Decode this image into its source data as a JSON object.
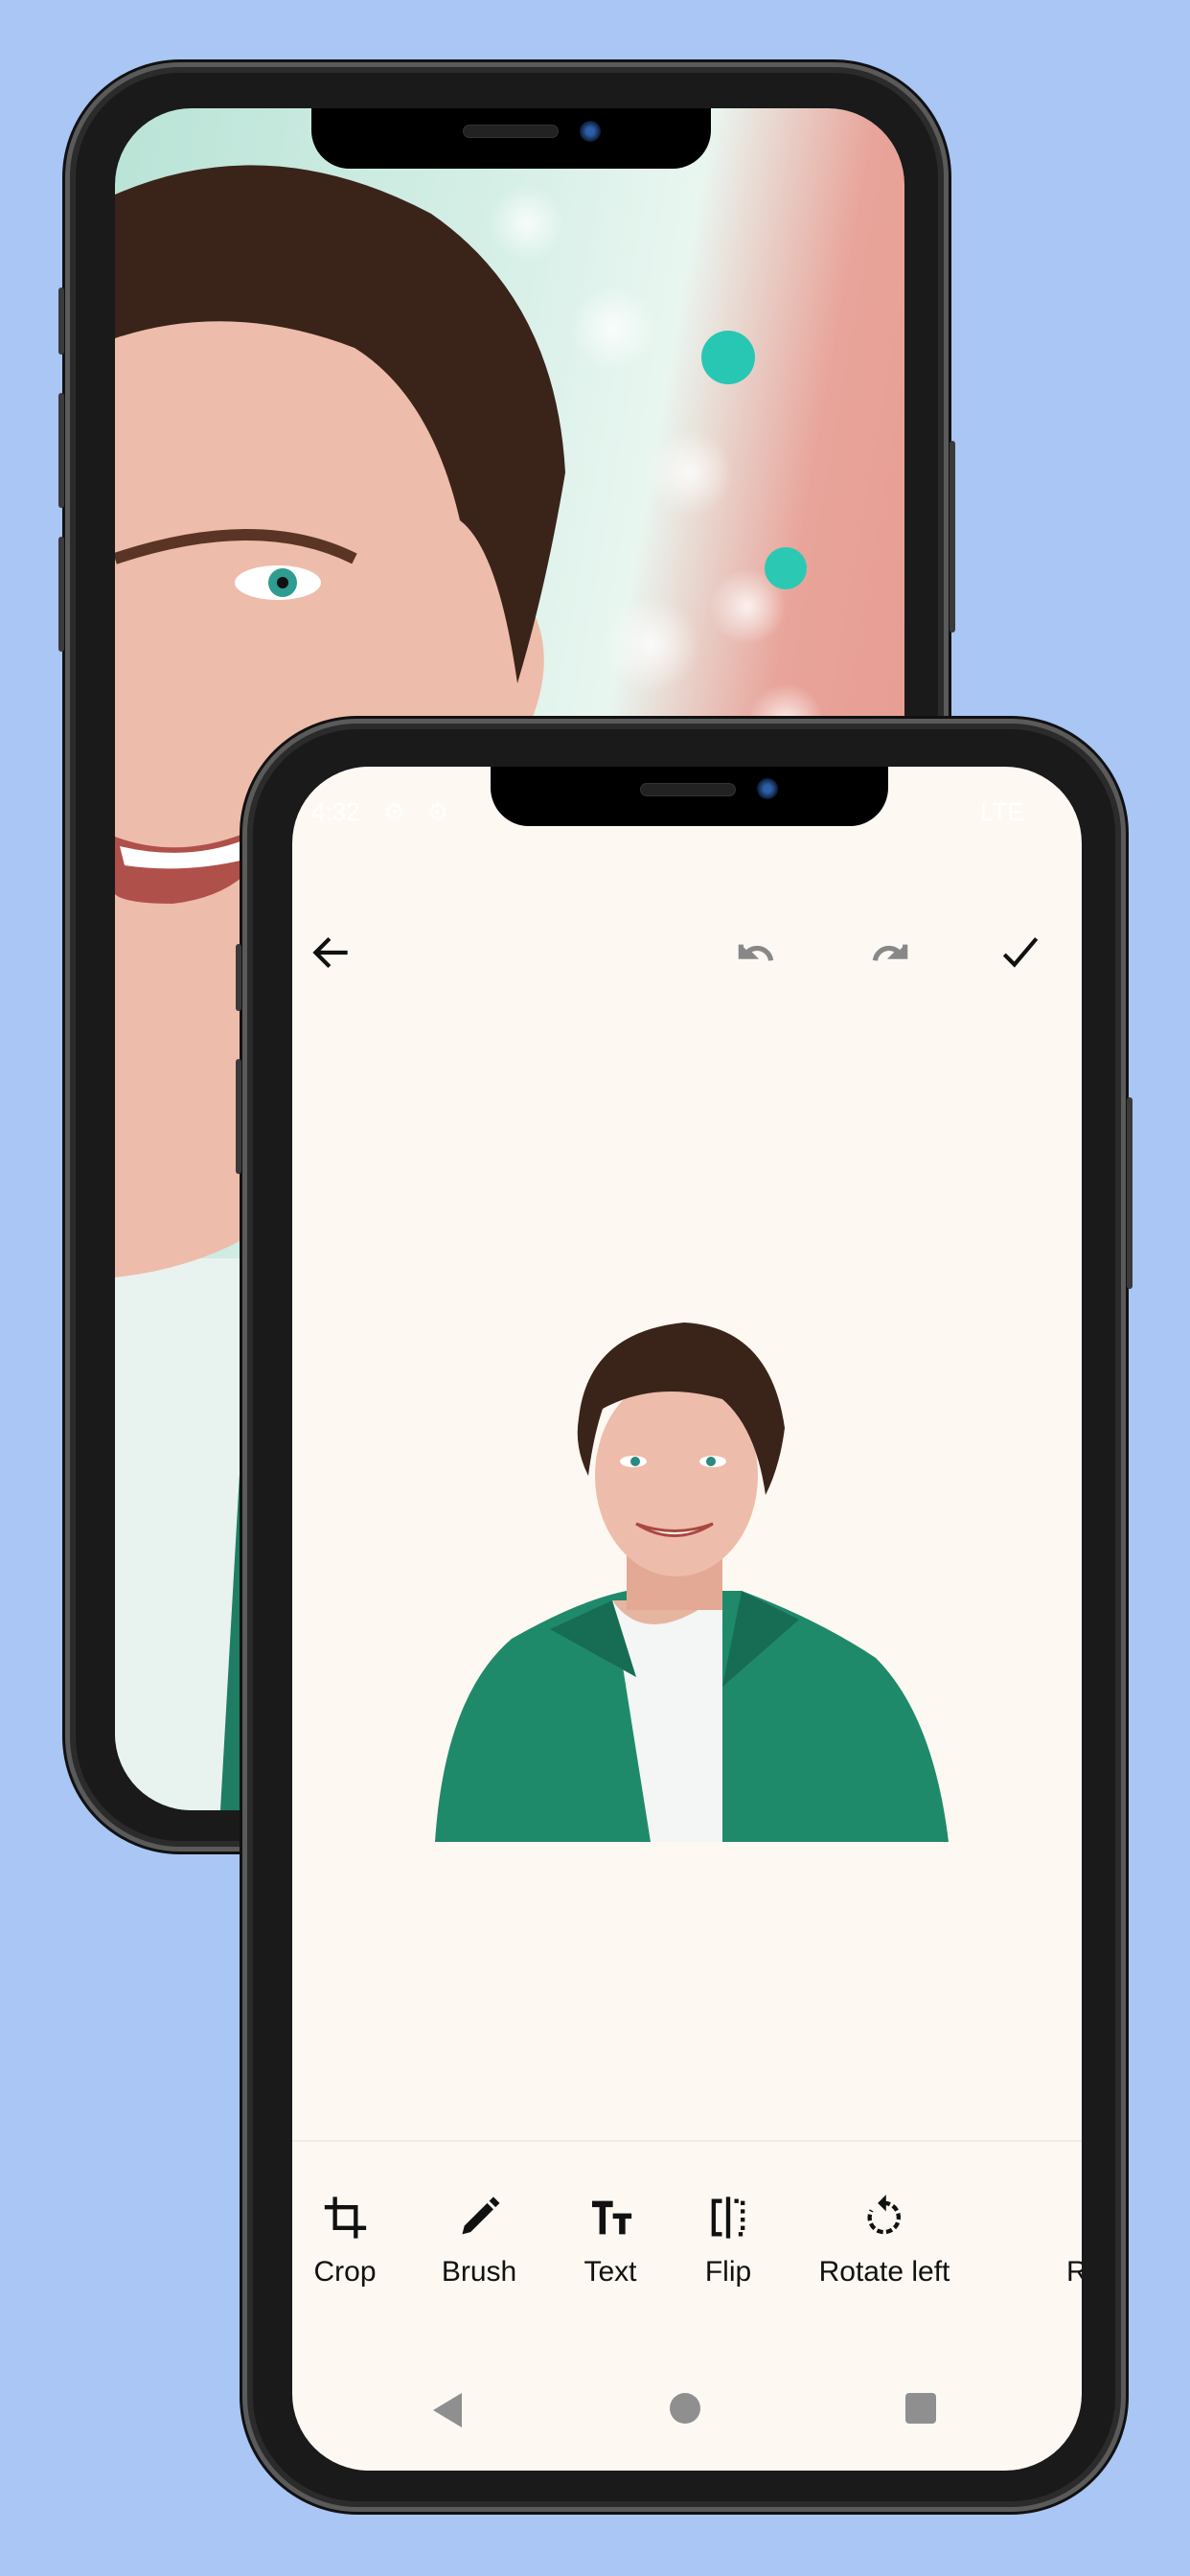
{
  "status_bar": {
    "time": "4:32",
    "network": "LTE"
  },
  "toolbar": {
    "back_icon": "arrow-left-icon",
    "undo_icon": "undo-icon",
    "redo_icon": "redo-icon",
    "confirm_icon": "check-icon"
  },
  "tools": [
    {
      "label": "Crop",
      "icon": "crop-icon"
    },
    {
      "label": "Brush",
      "icon": "brush-icon"
    },
    {
      "label": "Text",
      "icon": "text-size-icon"
    },
    {
      "label": "Flip",
      "icon": "flip-icon"
    },
    {
      "label": "Rotate left",
      "icon": "rotate-left-icon"
    },
    {
      "label": "Rota",
      "icon": "rotate-right-icon"
    }
  ],
  "colors": {
    "background": "#a9c6f4",
    "screen": "#fdf8f2",
    "shirt": "#1f8a6a"
  }
}
